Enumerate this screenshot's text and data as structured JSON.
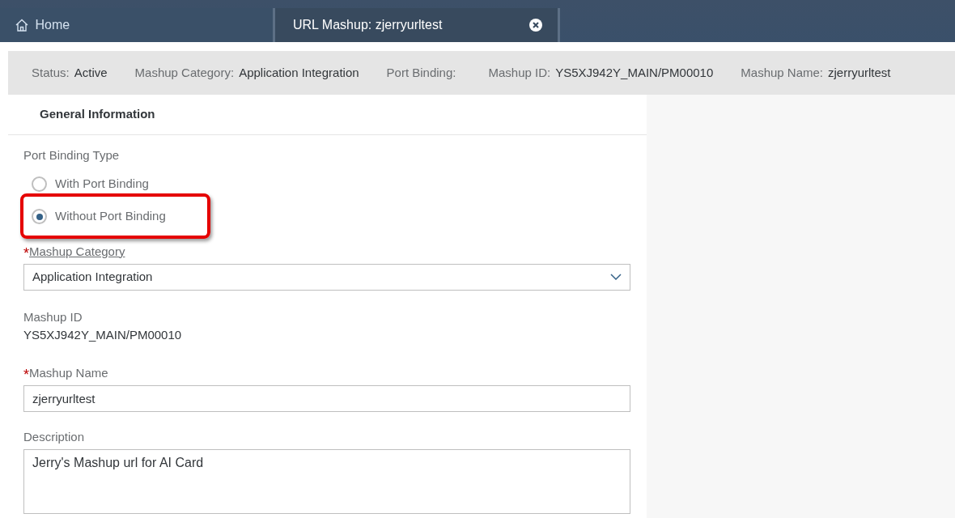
{
  "tabs": [
    {
      "label": "Home",
      "kind": "home",
      "selected": false
    },
    {
      "label": "URL Mashup: zjerryurltest",
      "kind": "document",
      "selected": true
    }
  ],
  "header_fields": [
    {
      "label": "Status:",
      "value": "Active"
    },
    {
      "label": "Mashup Category:",
      "value": "Application Integration"
    },
    {
      "label": "Port Binding:"
    },
    {
      "label": "Mashup ID:",
      "value": "YS5XJ942Y_MAIN/PM00010"
    },
    {
      "label": "Mashup Name:",
      "value": "zjerryurltest"
    }
  ],
  "section_title": "General Information",
  "port_binding": {
    "label": "Port Binding Type",
    "options": [
      {
        "label": "With Port Binding",
        "selected": false,
        "highlighted": false
      },
      {
        "label": "Without Port Binding",
        "selected": true,
        "highlighted": true
      }
    ]
  },
  "fields": [
    {
      "kind": "select",
      "label": "Mashup Category",
      "required_mark": "*",
      "value": "Application Integration"
    },
    {
      "kind": "static",
      "label": "Mashup ID",
      "value": "YS5XJ942Y_MAIN/PM00010"
    },
    {
      "kind": "input",
      "label": "Mashup Name",
      "required_mark": "*",
      "value": "zjerryurltest"
    },
    {
      "kind": "textarea",
      "label": "Description",
      "value": "Jerry's Mashup url for AI Card"
    }
  ]
}
